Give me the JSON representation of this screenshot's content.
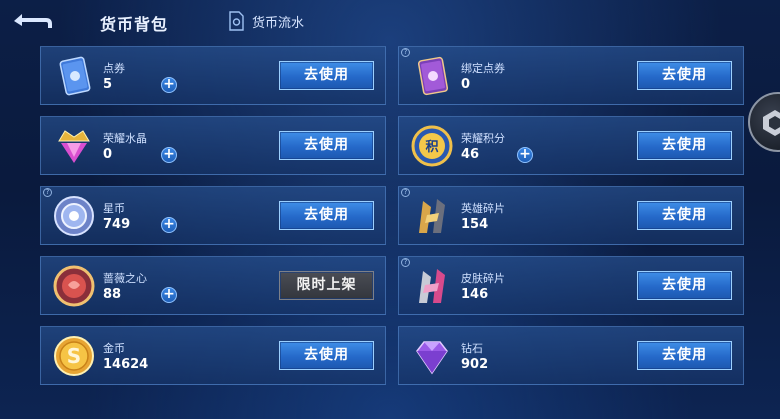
{
  "header": {
    "title": "货币背包",
    "flow_label": "货币流水"
  },
  "cards": [
    {
      "name": "点券",
      "value": "5",
      "button": "去使用",
      "has_plus": true,
      "has_q": false,
      "icon": "coupon-icon"
    },
    {
      "name": "绑定点券",
      "value": "0",
      "button": "去使用",
      "has_plus": false,
      "has_q": true,
      "icon": "bound-coupon-icon"
    },
    {
      "name": "荣耀水晶",
      "value": "0",
      "button": "去使用",
      "has_plus": true,
      "has_q": false,
      "icon": "glory-crystal-icon"
    },
    {
      "name": "荣耀积分",
      "value": "46",
      "button": "去使用",
      "has_plus": true,
      "has_q": false,
      "icon": "glory-points-icon"
    },
    {
      "name": "星币",
      "value": "749",
      "button": "去使用",
      "has_plus": true,
      "has_q": true,
      "icon": "star-coin-icon"
    },
    {
      "name": "英雄碎片",
      "value": "154",
      "button": "去使用",
      "has_plus": false,
      "has_q": true,
      "icon": "hero-fragment-icon"
    },
    {
      "name": "蔷薇之心",
      "value": "88",
      "button": "限时上架",
      "has_plus": true,
      "has_q": false,
      "icon": "rose-heart-icon"
    },
    {
      "name": "皮肤碎片",
      "value": "146",
      "button": "去使用",
      "has_plus": false,
      "has_q": true,
      "icon": "skin-fragment-icon"
    },
    {
      "name": "金币",
      "value": "14624",
      "button": "去使用",
      "has_plus": false,
      "has_q": false,
      "icon": "gold-coin-icon"
    },
    {
      "name": "钻石",
      "value": "902",
      "button": "去使用",
      "has_plus": false,
      "has_q": false,
      "icon": "diamond-icon"
    }
  ]
}
